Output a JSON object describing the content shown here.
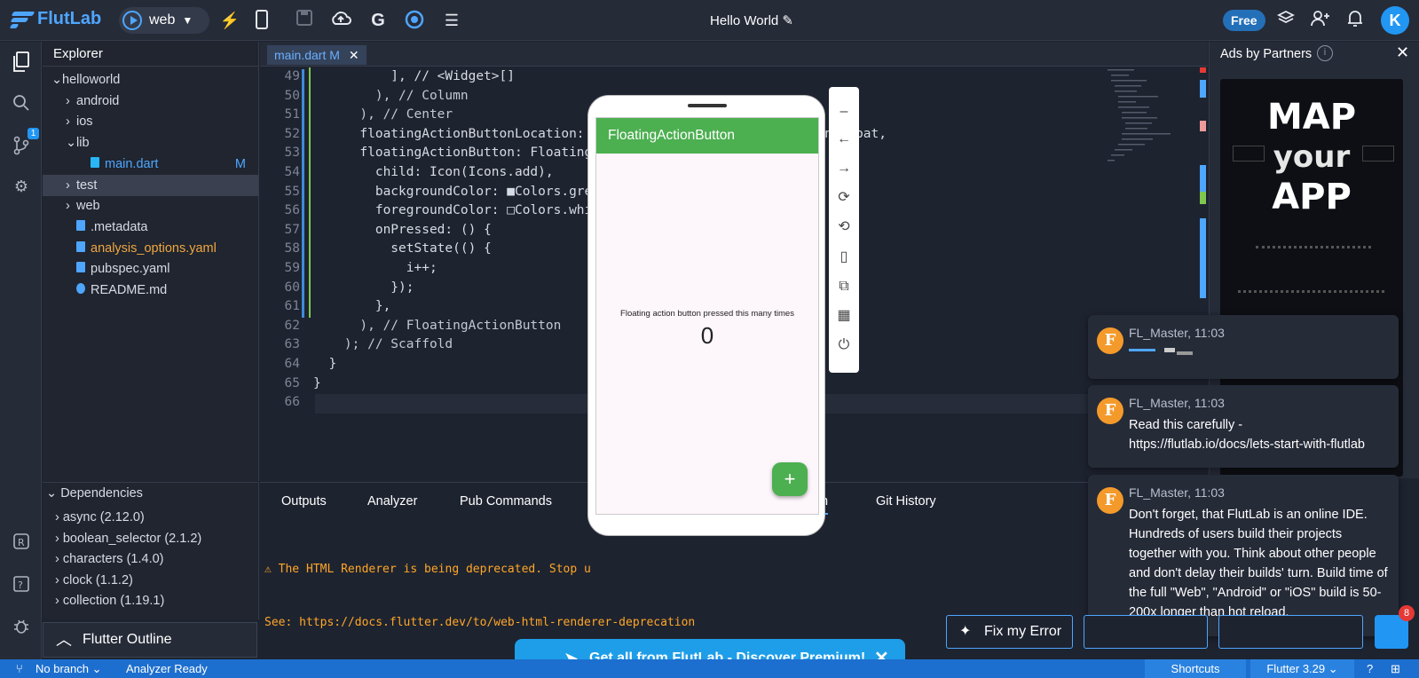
{
  "app": {
    "brand": "FlutLab",
    "target": "web",
    "project_title": "Hello World",
    "plan_badge": "Free",
    "user_initial": "K"
  },
  "toolbar": {
    "icons": [
      "lightning-icon",
      "phone-icon",
      "save-icon",
      "cloud-upload-icon",
      "google-icon",
      "target-icon",
      "menu-icon"
    ]
  },
  "activity": {
    "git_badge": "1"
  },
  "explorer": {
    "title": "Explorer",
    "items": [
      {
        "label": "helloworld",
        "arrow": "⌄",
        "indent": 0
      },
      {
        "label": "android",
        "arrow": "›",
        "indent": 1
      },
      {
        "label": "ios",
        "arrow": "›",
        "indent": 1
      },
      {
        "label": "lib",
        "arrow": "⌄",
        "indent": 1
      },
      {
        "label": "main.dart",
        "arrow": "",
        "indent": 2,
        "suffix": "M"
      },
      {
        "label": "test",
        "arrow": "›",
        "indent": 1
      },
      {
        "label": "web",
        "arrow": "›",
        "indent": 1
      },
      {
        "label": ".metadata",
        "arrow": "",
        "indent": 1
      },
      {
        "label": "analysis_options.yaml",
        "arrow": "",
        "indent": 1
      },
      {
        "label": "pubspec.yaml",
        "arrow": "",
        "indent": 1
      },
      {
        "label": "README.md",
        "arrow": "",
        "indent": 1
      }
    ]
  },
  "dependencies": {
    "title": "Dependencies",
    "items": [
      "async (2.12.0)",
      "boolean_selector (2.1.2)",
      "characters (1.4.0)",
      "clock (1.1.2)",
      "collection (1.19.1)"
    ]
  },
  "outline": {
    "label": "Flutter Outline"
  },
  "editor": {
    "tab": "main.dart M",
    "lines": [
      {
        "n": "49",
        "code": "          ], // <Widget>[]"
      },
      {
        "n": "50",
        "code": "        ), // Column"
      },
      {
        "n": "51",
        "code": "      ), // Center"
      },
      {
        "n": "52",
        "code": "      floatingActionButtonLocation: FloatingActionButtonLocation.endFloat,"
      },
      {
        "n": "53",
        "code": "      floatingActionButton: FloatingActionButton("
      },
      {
        "n": "54",
        "code": "        child: Icon(Icons.add),"
      },
      {
        "n": "55",
        "code": "        backgroundColor: ■Colors.green,"
      },
      {
        "n": "56",
        "code": "        foregroundColor: □Colors.white,"
      },
      {
        "n": "57",
        "code": "        onPressed: () {"
      },
      {
        "n": "58",
        "code": "          setState(() {"
      },
      {
        "n": "59",
        "code": "            i++;"
      },
      {
        "n": "60",
        "code": "          });"
      },
      {
        "n": "61",
        "code": "        },"
      },
      {
        "n": "62",
        "code": "      ), // FloatingActionButton"
      },
      {
        "n": "63",
        "code": "    ); // Scaffold"
      },
      {
        "n": "64",
        "code": "  }"
      },
      {
        "n": "65",
        "code": "}"
      },
      {
        "n": "66",
        "code": ""
      }
    ]
  },
  "bottom_panel": {
    "tabs": [
      "Outputs",
      "Analyzer",
      "Pub Commands",
      "n",
      "Git History"
    ],
    "console": [
      "⚠ The HTML Renderer is being deprecated. Stop u",
      "See: https://docs.flutter.dev/to/web-html-renderer-deprecation"
    ]
  },
  "ads": {
    "title": "Ads by Partners",
    "banner_lines": [
      "MAP",
      "your",
      "APP"
    ]
  },
  "emulator": {
    "appbar_title": "FloatingActionButton",
    "message": "Floating action button pressed this many times",
    "count": "0",
    "fab_label": "+"
  },
  "chat_messages": [
    {
      "author": "FL_Master, 11:03",
      "text": ""
    },
    {
      "author": "FL_Master, 11:03",
      "text": "Read this carefully - https://flutlab.io/docs/lets-start-with-flutlab"
    },
    {
      "author": "FL_Master, 11:03",
      "text": "Don't forget, that FlutLab is an online IDE. Hundreds of users build their projects together with you. Think about other people and don't delay their builds' turn. Build time of the full \"Web\", \"Android\" or \"iOS\" build is 50-200x longer than hot reload."
    }
  ],
  "buttons": {
    "fix_error": "Fix my Error",
    "chat_count": "8"
  },
  "promo": {
    "text": "Get all from FlutLab - Discover Premium!"
  },
  "statusbar": {
    "branch": "No branch",
    "analyzer": "Analyzer Ready",
    "shortcuts": "Shortcuts",
    "flutter": "Flutter 3.29"
  },
  "colors": {
    "accent": "#2196f3",
    "app_green": "#4caf50",
    "avatar_orange": "#f49a2b",
    "statusbar": "#1d6fcf"
  }
}
